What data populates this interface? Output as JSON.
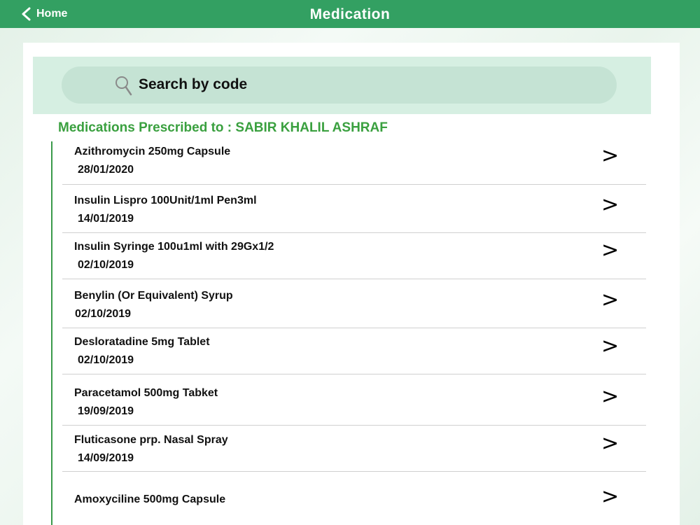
{
  "header": {
    "back_label": "Home",
    "title": "Medication"
  },
  "search": {
    "placeholder": "Search by code"
  },
  "prescribed": {
    "heading": "Medications Prescribed to :  SABIR KHALIL ASHRAF"
  },
  "medications": [
    {
      "name": "Azithromycin 250mg Capsule",
      "date": "28/01/2020",
      "chevron": ">"
    },
    {
      "name": "Insulin Lispro 100Unit/1ml Pen3ml",
      "date": "14/01/2019",
      "chevron": ">"
    },
    {
      "name": "Insulin Syringe 100u1ml with 29Gx1/2",
      "date": "02/10/2019",
      "chevron": ">"
    },
    {
      "name": "Benylin (Or Equivalent) Syrup",
      "date": "02/10/2019",
      "chevron": ">"
    },
    {
      "name": "Desloratadine 5mg Tablet",
      "date": "02/10/2019",
      "chevron": ">"
    },
    {
      "name": "Paracetamol 500mg Tabket",
      "date": "19/09/2019",
      "chevron": ">"
    },
    {
      "name": "Fluticasone prp. Nasal Spray",
      "date": "14/09/2019",
      "chevron": ">"
    },
    {
      "name": "Amoxyciline 500mg Capsule",
      "date": "",
      "chevron": ">"
    }
  ],
  "colors": {
    "header_bg": "#33a062",
    "heading_text": "#3aa03f",
    "search_band": "#d6efe2",
    "search_pill": "#c5e3d4"
  },
  "icons": {
    "back": "chevron-left-icon",
    "search": "search-icon",
    "row": "chevron-right-icon"
  }
}
